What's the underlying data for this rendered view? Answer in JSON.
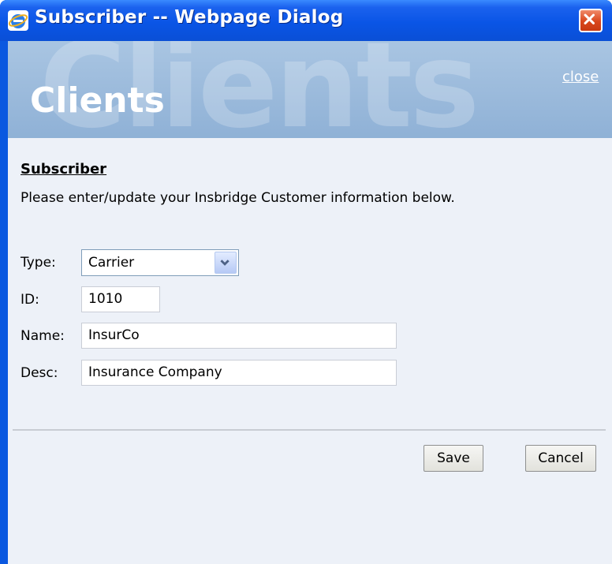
{
  "window": {
    "title": "Subscriber -- Webpage Dialog",
    "close_button": "close-x"
  },
  "banner": {
    "watermark": "Clients",
    "title": "Clients",
    "close_link": "close"
  },
  "form": {
    "section_title": "Subscriber",
    "instructions": "Please enter/update your Insbridge Customer information below.",
    "type": {
      "label": "Type:",
      "value": "Carrier"
    },
    "id": {
      "label": "ID:",
      "value": "1010"
    },
    "name": {
      "label": "Name:",
      "value": "InsurCo"
    },
    "desc": {
      "label": "Desc:",
      "value": "Insurance Company"
    }
  },
  "buttons": {
    "save": "Save",
    "cancel": "Cancel"
  },
  "colors": {
    "titlebar": "#0a55e6",
    "banner": "#9dbbdc",
    "dialog_background": "#edf1f8",
    "close_button": "#d9461c"
  }
}
